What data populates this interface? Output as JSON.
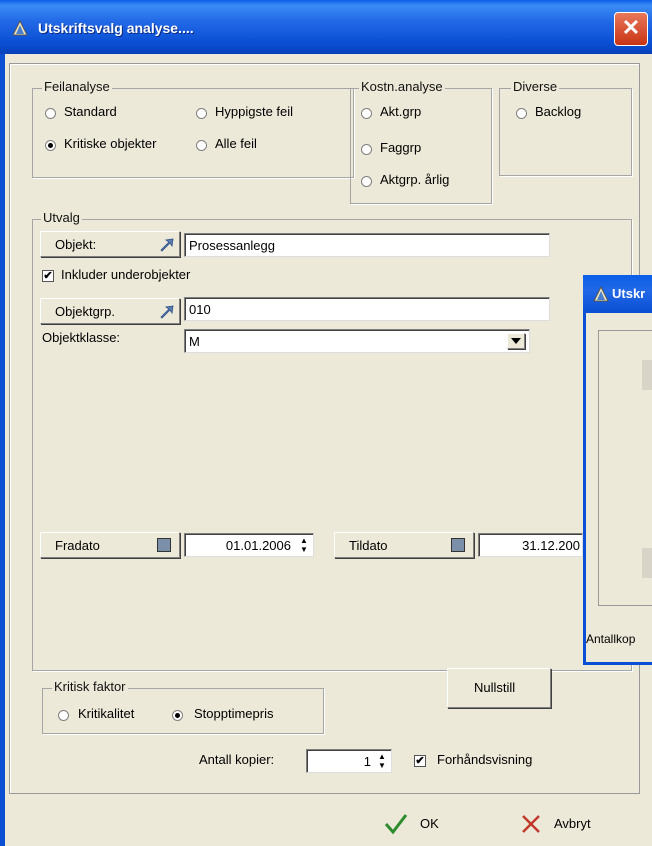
{
  "window": {
    "title": "Utskriftsvalg analyse....",
    "close_glyph": "✕"
  },
  "feilanalyse": {
    "legend": "Feilanalyse",
    "options": [
      {
        "label": "Standard",
        "checked": false
      },
      {
        "label": "Hyppigste feil",
        "checked": false
      },
      {
        "label": "Kritiske objekter",
        "checked": true
      },
      {
        "label": "Alle feil",
        "checked": false
      }
    ]
  },
  "kostn": {
    "legend": "Kostn.analyse",
    "options": [
      {
        "label": "Akt.grp",
        "checked": false
      },
      {
        "label": "Faggrp",
        "checked": false
      },
      {
        "label": "Aktgrp. årlig",
        "checked": false
      }
    ]
  },
  "diverse": {
    "legend": "Diverse",
    "options": [
      {
        "label": "Backlog",
        "checked": false
      }
    ]
  },
  "utvalg": {
    "legend": "Utvalg",
    "objekt_button": "Objekt:",
    "objekt_value": "Prosessanlegg",
    "include_sub_label": "Inkluder underobjekter",
    "include_sub_checked": true,
    "objektgrp_button": "Objektgrp.",
    "objektgrp_value": "010",
    "objektklasse_label": "Objektklasse:",
    "objektklasse_value": "M",
    "fradato_button": "Fradato",
    "fradato_value": "01.01.2006",
    "tildato_button": "Tildato",
    "tildato_value": "31.12.200"
  },
  "kritisk": {
    "legend": "Kritisk faktor",
    "options": [
      {
        "label": "Kritikalitet",
        "checked": false
      },
      {
        "label": "Stopptimepris",
        "checked": true
      }
    ]
  },
  "nullstill_button": "Nullstill",
  "antall": {
    "label": "Antall kopier:",
    "value": "1"
  },
  "preview": {
    "label": "Forhåndsvisning",
    "checked": true
  },
  "footer": {
    "ok": "OK",
    "cancel": "Avbryt"
  },
  "second_window": {
    "title": "Utskr",
    "footer_label": "Antallkop"
  },
  "colors": {
    "titlebar": "#0a4fd4",
    "face": "#ece9d8",
    "ok_check": "#2e8b2e",
    "cancel_x": "#c0392b"
  }
}
